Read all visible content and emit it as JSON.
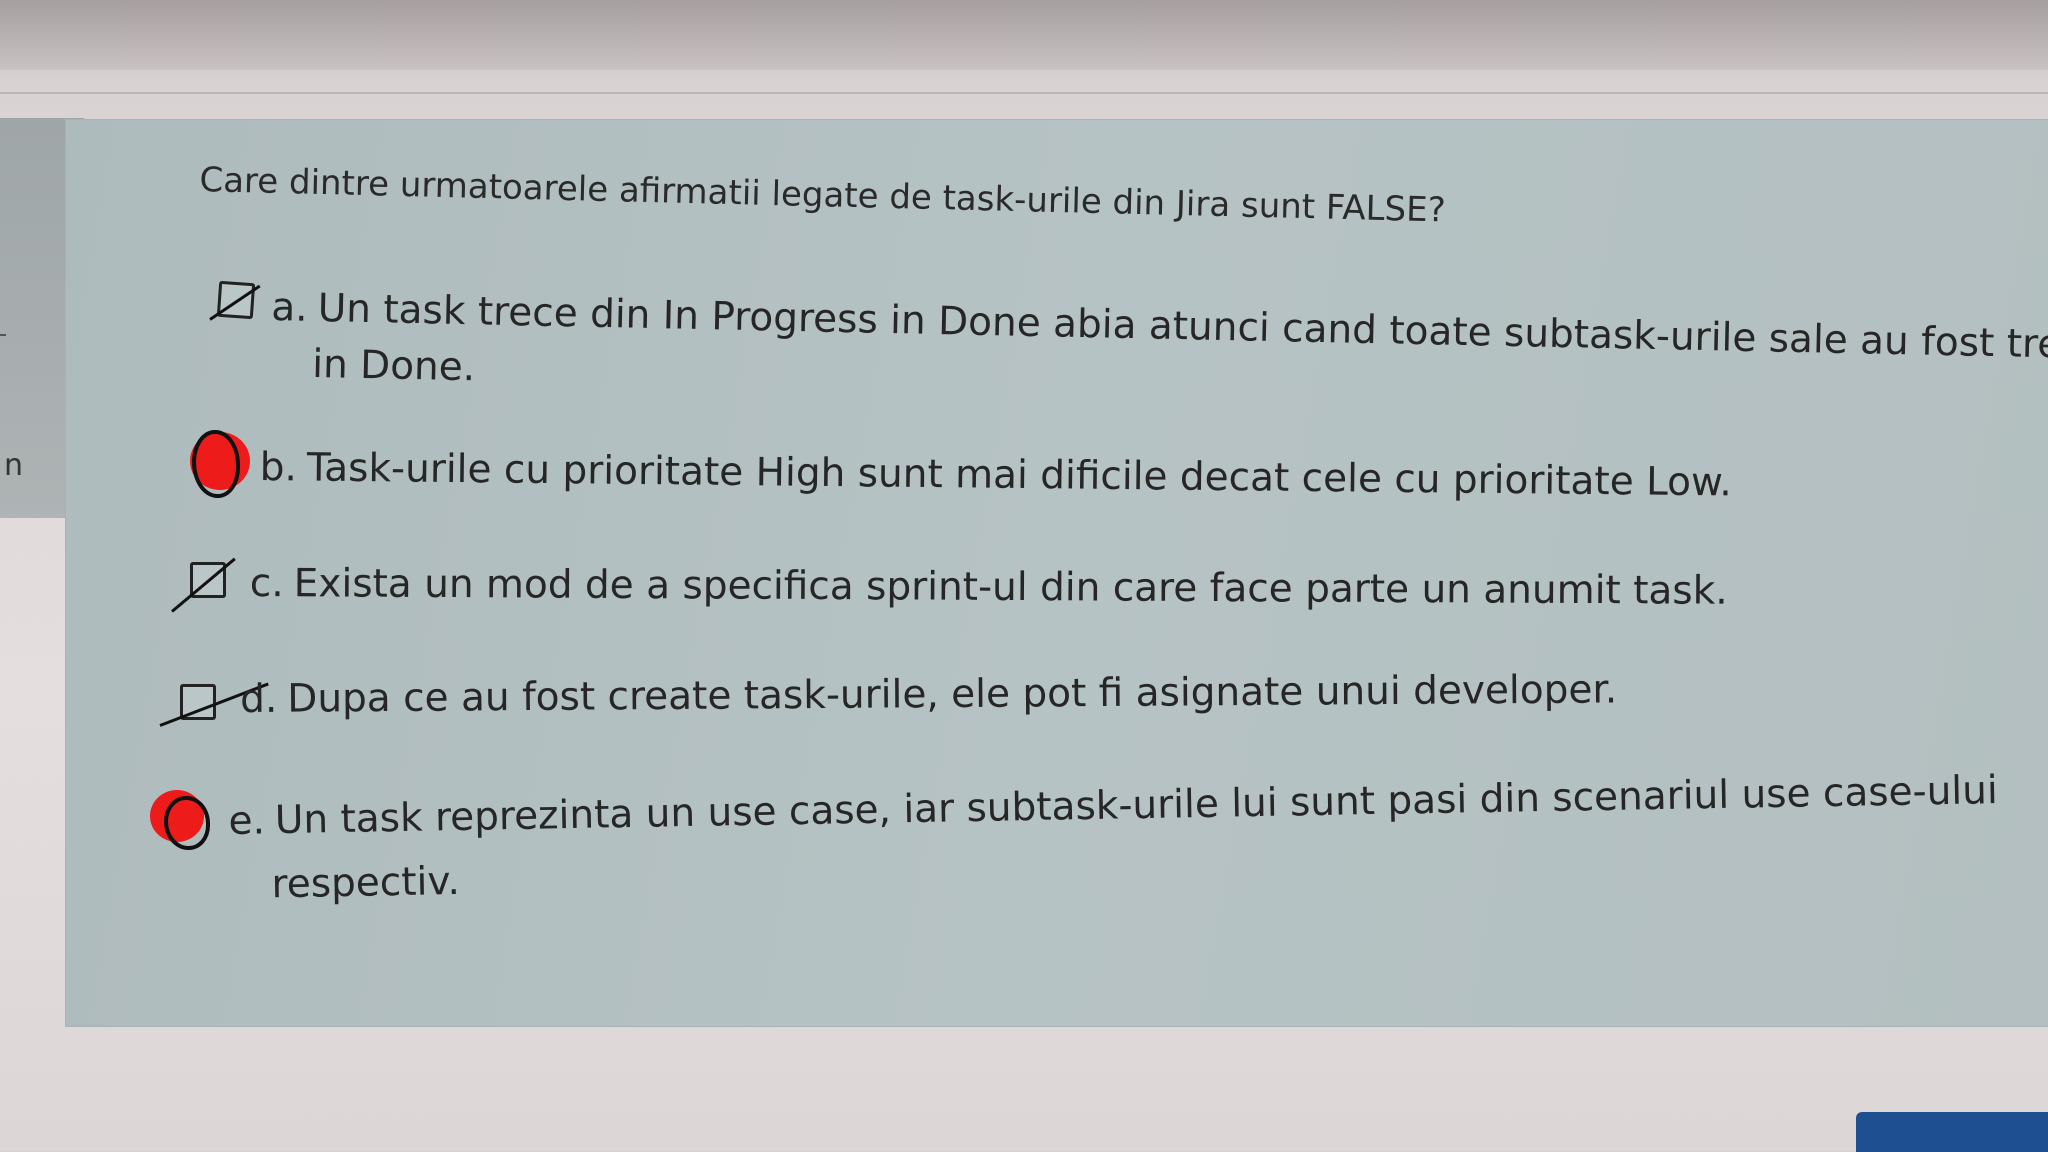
{
  "sidebar": {
    "partial_label": "n"
  },
  "question": {
    "text": "Care dintre urmatoarele afirmatii legate de task-urile din Jira sunt FALSE?",
    "options": [
      {
        "letter": "a.",
        "line1": "Un task trece din In Progress in Done abia atunci cand toate subtask-urile sale au fost trecute",
        "line2": "in Done.",
        "mark": "crossed-out"
      },
      {
        "letter": "b.",
        "line1": "Task-urile cu prioritate High sunt mai dificile decat cele cu prioritate Low.",
        "mark": "circled-red"
      },
      {
        "letter": "c.",
        "line1": "Exista un mod de a specifica sprint-ul din care face parte un anumit task.",
        "mark": "crossed-out"
      },
      {
        "letter": "d.",
        "line1": "Dupa ce au fost create task-urile, ele pot fi asignate unui developer.",
        "mark": "crossed-out"
      },
      {
        "letter": "e.",
        "line1": "Un task reprezinta un use case, iar subtask-urile lui sunt pasi din scenariul use case-ului",
        "line2": "respectiv.",
        "mark": "circled-red"
      }
    ]
  },
  "colors": {
    "card_background": "#b6c3c4",
    "page_background": "#e4dede",
    "annotation_red": "#ee1b1b",
    "corner_button": "#1d4f91"
  }
}
